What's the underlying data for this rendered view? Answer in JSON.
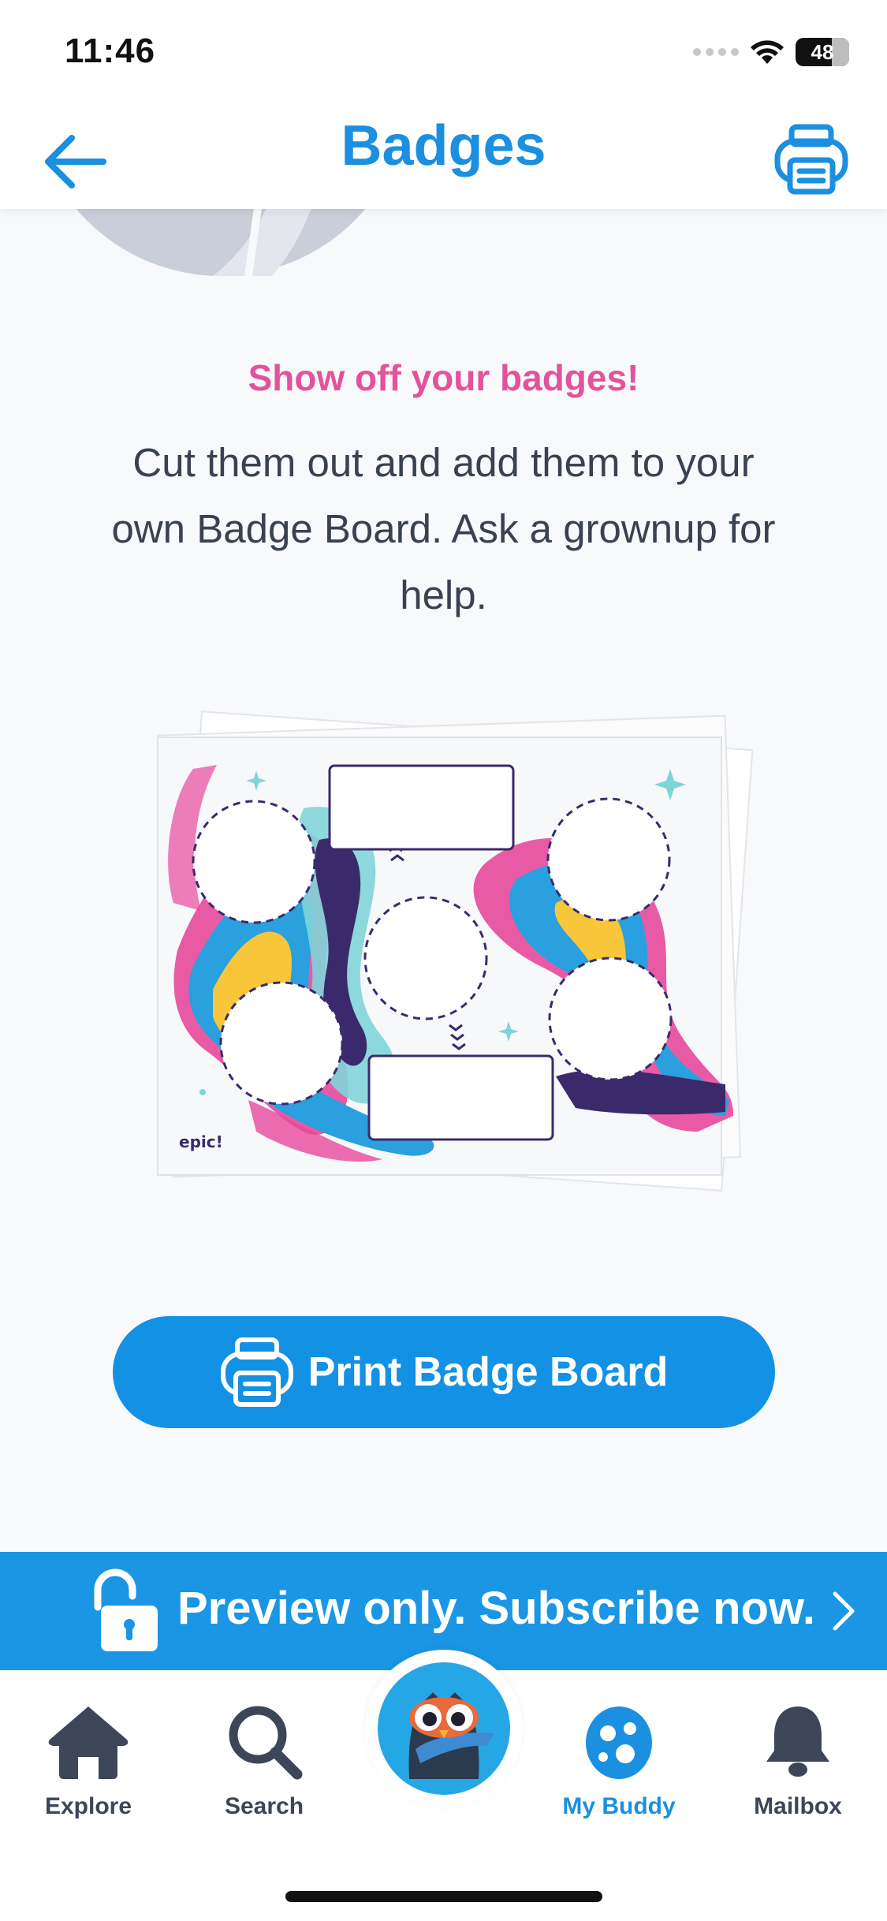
{
  "status": {
    "time": "11:46",
    "battery": "48"
  },
  "header": {
    "title": "Badges"
  },
  "content": {
    "subtitle": "Show off your badges!",
    "description": "Cut them out and add them to your own Badge Board. Ask a grownup for help.",
    "board_logo": "epic!"
  },
  "print_button": {
    "label": "Print Badge Board"
  },
  "subscribe_banner": {
    "text": "Preview only. Subscribe now."
  },
  "tabs": [
    {
      "label": "Explore",
      "icon": "home-icon"
    },
    {
      "label": "Search",
      "icon": "search-icon"
    },
    {
      "label": "My Buddy",
      "icon": "egg-icon",
      "active": true
    },
    {
      "label": "Mailbox",
      "icon": "bell-icon"
    }
  ],
  "colors": {
    "primary": "#1b8fe0",
    "accent_pink": "#e3529b",
    "banner": "#1a96e4",
    "text": "#3a4150"
  }
}
